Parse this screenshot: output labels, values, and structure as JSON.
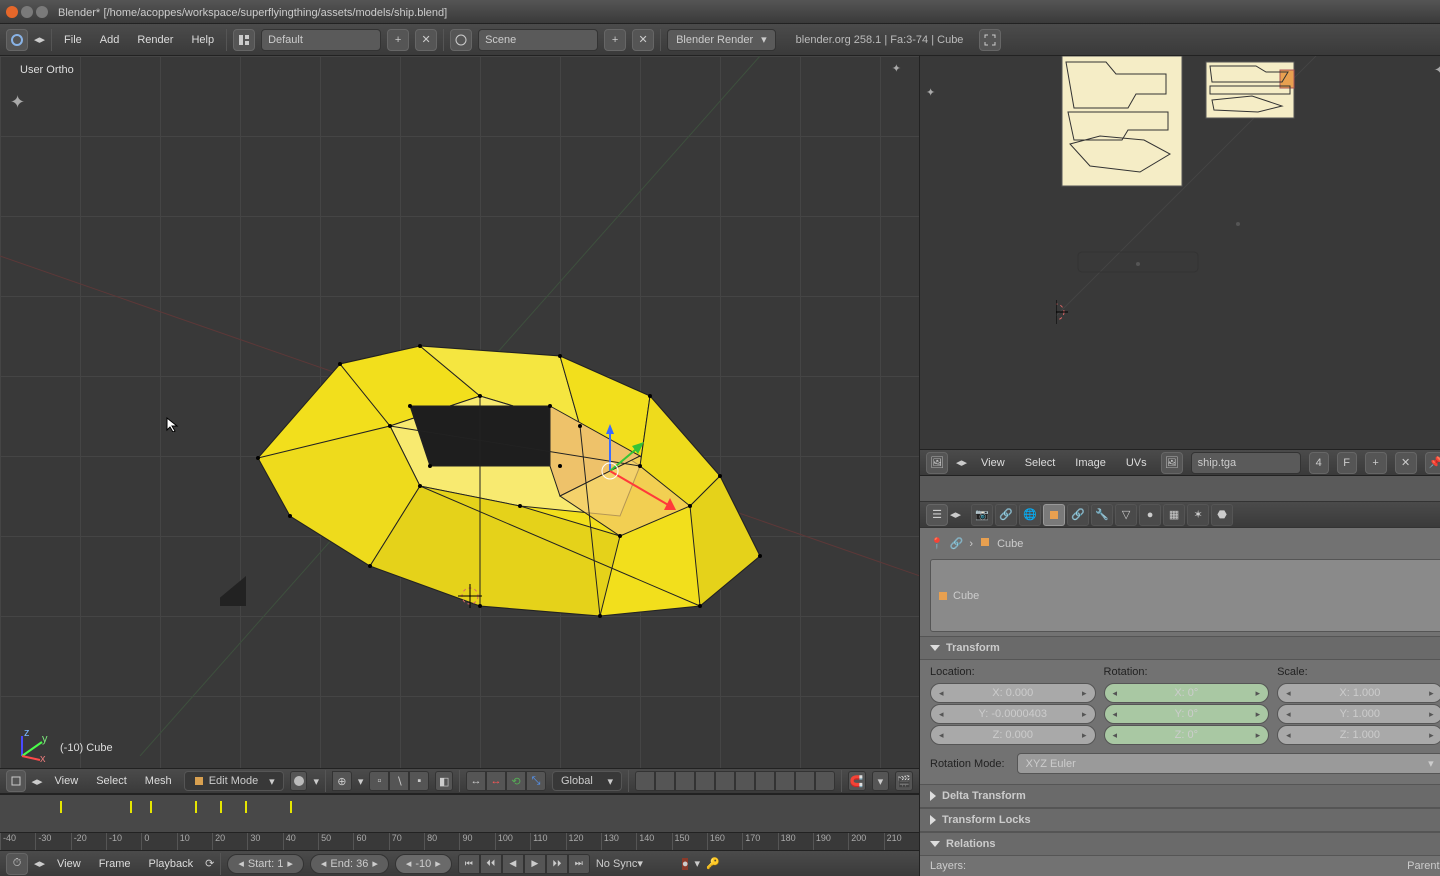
{
  "titlebar": {
    "app": "Blender",
    "file_marker": "*",
    "path": "[/home/acoppes/workspace/superflyingthing/assets/models/ship.blend]"
  },
  "info_header": {
    "menu_file": "File",
    "menu_add": "Add",
    "menu_render": "Render",
    "menu_help": "Help",
    "layout_name": "Default",
    "scene_name": "Scene",
    "engine": "Blender Render",
    "status": "blender.org 258.1 | Fa:3-74 | Cube"
  },
  "viewport": {
    "orientation_label": "User Ortho",
    "object_label": "(-10) Cube",
    "header": {
      "menu_view": "View",
      "menu_select": "Select",
      "menu_mesh": "Mesh",
      "mode": "Edit Mode",
      "orientation": "Global"
    }
  },
  "uv_editor": {
    "menu_view": "View",
    "menu_select": "Select",
    "menu_image": "Image",
    "menu_uvs": "UVs",
    "image_name": "ship.tga",
    "index": "4",
    "btn_f": "F"
  },
  "properties": {
    "breadcrumb_obj": "Cube",
    "name_field": "Cube",
    "panels": {
      "transform": "Transform",
      "delta": "Delta Transform",
      "locks": "Transform Locks",
      "relations": "Relations"
    },
    "transform": {
      "loc_label": "Location:",
      "rot_label": "Rotation:",
      "scale_label": "Scale:",
      "loc_x": "X: 0.000",
      "loc_y": "Y: -0.0000403",
      "loc_z": "Z: 0.000",
      "rot_x": "X: 0°",
      "rot_y": "Y: 0°",
      "rot_z": "Z: 0°",
      "scale_x": "X: 1.000",
      "scale_y": "Y: 1.000",
      "scale_z": "Z: 1.000",
      "rot_mode_label": "Rotation Mode:",
      "rot_mode_value": "XYZ Euler"
    },
    "relations": {
      "layers_label": "Layers:",
      "parent_label": "Parent:"
    }
  },
  "timeline": {
    "menu_view": "View",
    "menu_frame": "Frame",
    "menu_playback": "Playback",
    "start_label": "Start: 1",
    "end_label": "End: 36",
    "current": "-10",
    "sync": "No Sync",
    "ticks": [
      "-40",
      "-30",
      "-20",
      "-10",
      "0",
      "10",
      "20",
      "30",
      "40",
      "50",
      "60",
      "70",
      "80",
      "90",
      "100",
      "110",
      "120",
      "130",
      "140",
      "150",
      "160",
      "170",
      "180",
      "190",
      "200",
      "210"
    ],
    "key_positions": [
      60,
      130,
      150,
      195,
      220,
      245,
      290
    ]
  }
}
